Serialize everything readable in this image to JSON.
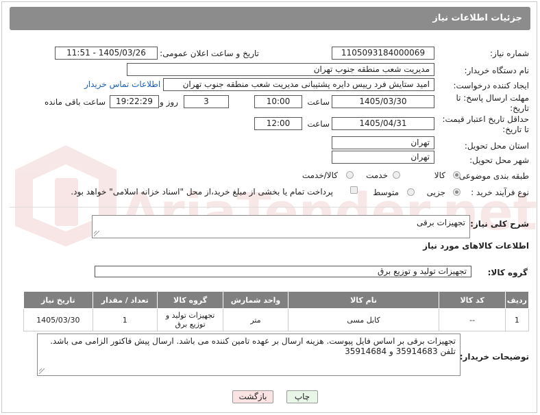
{
  "header": {
    "title": "جزئیات اطلاعات نیاز"
  },
  "fields": {
    "need_number_label": "شماره نیاز:",
    "need_number": "1105093184000069",
    "announce_label": "تاریخ و ساعت اعلان عمومی:",
    "announce_value": "1405/03/26 - 11:51",
    "buyer_org_label": "نام دستگاه خریدار:",
    "buyer_org": "مدیریت شعب منطقه جنوب تهران",
    "requester_label": "ایجاد کننده درخواست:",
    "requester": "امید ستایش فرد رییس دایره پشتیبانی مدیریت شعب منطقه جنوب تهران",
    "contact_link": "اطلاعات تماس خریدار",
    "reply_deadline_label_1": "مهلت ارسال پاسخ: تا",
    "reply_deadline_label_2": "تاریخ:",
    "reply_date": "1405/03/30",
    "time_label": "ساعت",
    "reply_time": "10:00",
    "days": "3",
    "days_label": "روز و",
    "remaining_time": "19:22:29",
    "remaining_label": "ساعت باقی مانده",
    "price_deadline_label_1": "حداقل تاریخ اعتبار قیمت:",
    "price_deadline_label_2": "تا تاریخ:",
    "price_date": "1405/04/31",
    "price_time": "12:00",
    "province_label": "استان محل تحویل:",
    "province": "تهران",
    "city_label": "شهر محل تحویل:",
    "city": "تهران",
    "category_label": "طبقه بندی موضوعی:",
    "category_options": [
      "کالا",
      "خدمت",
      "کالا/خدمت"
    ],
    "category_selected": "کالا",
    "process_label": "نوع فرآیند خرید :",
    "process_options": [
      "جزیی",
      "متوسط"
    ],
    "process_selected": "جزیی",
    "payment_note": "پرداخت تمام یا بخشی از مبلغ خرید،از محل \"اسناد خزانه اسلامی\" خواهد بود."
  },
  "description": {
    "label": "شرح کلی نیاز:",
    "value": "تجهیزات برقی"
  },
  "goods": {
    "section_title": "اطلاعات کالاهای مورد نیاز",
    "group_label": "گروه کالا:",
    "group_value": "تجهیزات تولید و توزیع برق",
    "columns": [
      "ردیف",
      "کد کالا",
      "نام کالا",
      "واحد شمارش",
      "گروه کالا",
      "تعداد / مقدار",
      "تاریخ نیاز"
    ],
    "rows": [
      [
        "1",
        "--",
        "کابل مسی",
        "متر",
        "تجهیزات تولید و توزیع برق",
        "1",
        "1405/03/30"
      ]
    ]
  },
  "buyer_notes": {
    "label": "توضیحات خریدار:",
    "line1": "تجهیزات برقی بر اساس فایل پیوست. هزینه ارسال بر عهده تامین کننده می باشد. ارسال پیش فاکتور الزامی می باشد.",
    "line2": "تلفن 35914683 و 35914684"
  },
  "buttons": {
    "print": "چاپ",
    "back": "بازگشت"
  },
  "watermark": "AriaTender.net",
  "colors": {
    "header": "#8c8c8c",
    "link": "#1a5fb4",
    "print_btn": "#e8f6e8",
    "back_btn": "#fbe3e3"
  }
}
